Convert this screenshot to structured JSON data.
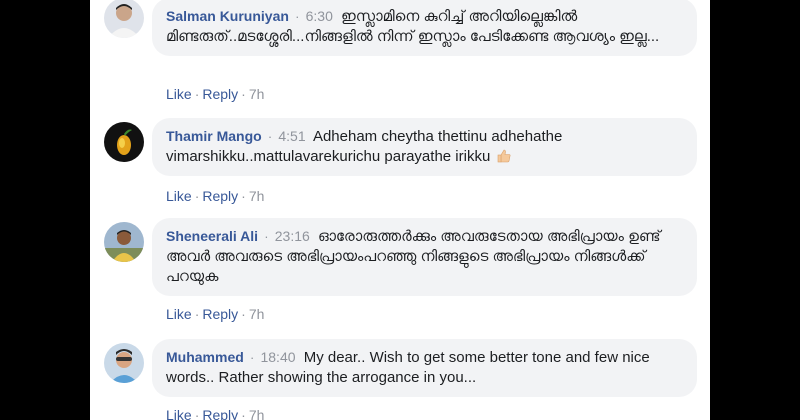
{
  "comments": [
    {
      "author": "Salman Kuruniyan",
      "time": "6:30",
      "text": "ഇസ്ലാമിനെ കുറിച്ച് അറിയില്ലെങ്കിൽ മിണ്ടരുത്..മടശ്ശേരി...നിങ്ങളിൽ നിന്ന് ഇസ്ലാം പേടിക്കേണ്ട ആവശ്യം ഇല്ല...",
      "like": "Like",
      "reply": "Reply",
      "age": "7h"
    },
    {
      "author": "Thamir Mango",
      "time": "4:51",
      "text": "Adheham cheytha thettinu adhehathe vimarshikku..mattulavarekurichu parayathe irikku",
      "emoji": "thumbs-up-emoji",
      "like": "Like",
      "reply": "Reply",
      "age": "7h"
    },
    {
      "author": "Sheneerali Ali",
      "time": "23:16",
      "text": "ഓരോരുത്തർക്കും അവരുടേതായ അഭിപ്രായം ഉണ്ട് അവർ അവരുടെ അഭിപ്രായംപറഞ്ഞു നിങ്ങളുടെ അഭിപ്രായം നിങ്ങൾക്ക് പറയുക",
      "like": "Like",
      "reply": "Reply",
      "age": "7h"
    },
    {
      "author": "Muhammed",
      "time": "18:40",
      "text": "My dear.. Wish to get some better tone and few nice words.. Rather showing the arrogance in you...",
      "like": "Like",
      "reply": "Reply",
      "age": "7h"
    }
  ],
  "separator": "·",
  "colors": {
    "author": "#385898",
    "meta": "#90949c",
    "bubble": "#f2f3f5"
  }
}
